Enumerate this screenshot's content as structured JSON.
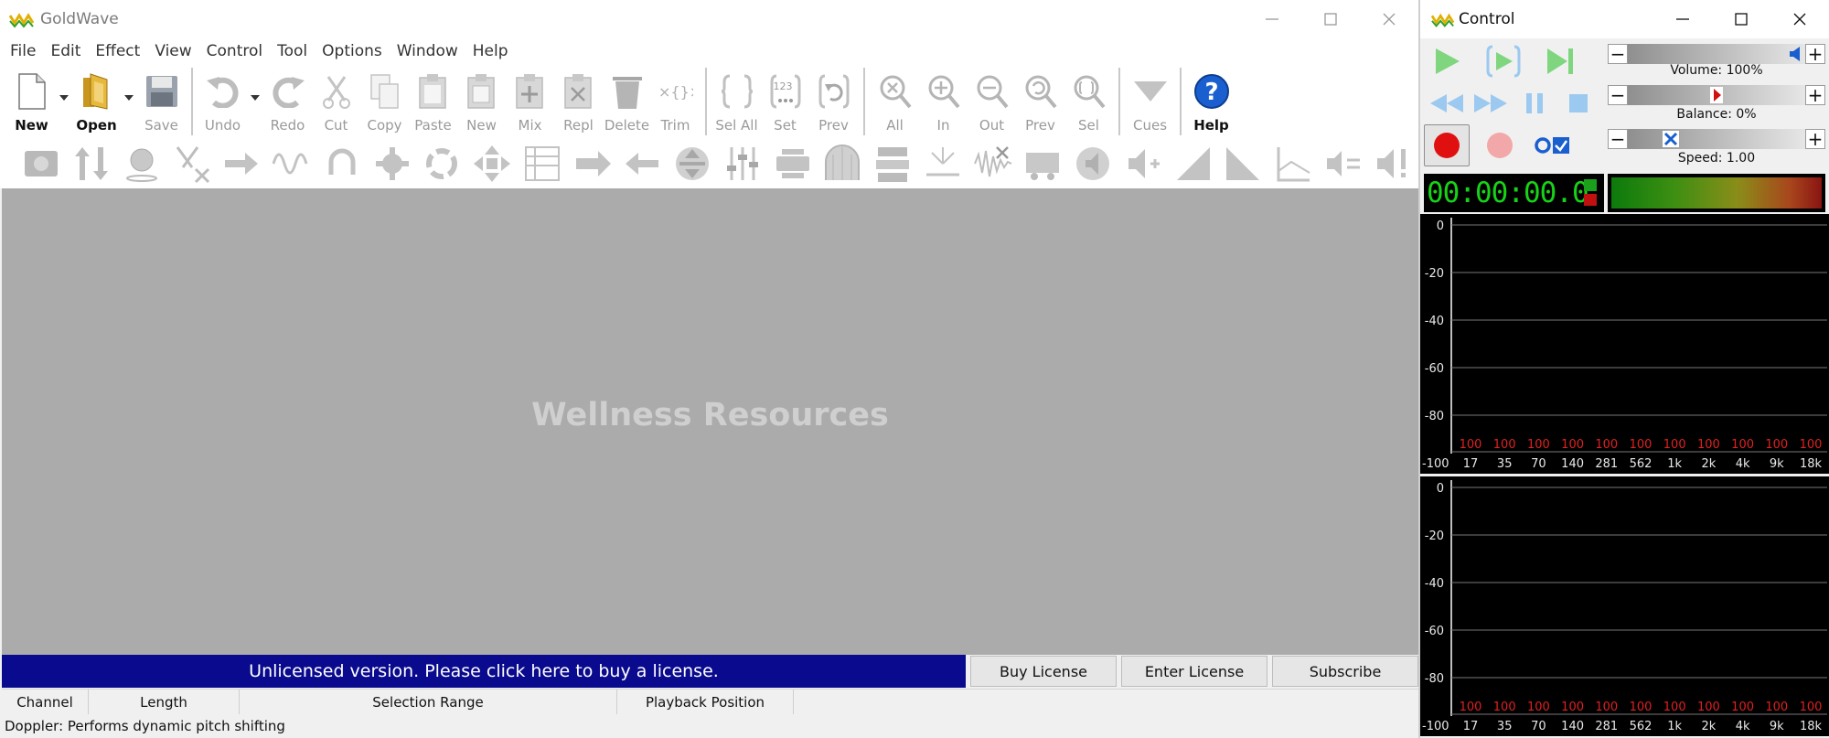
{
  "main_window": {
    "title": "GoldWave",
    "menu": [
      "File",
      "Edit",
      "Effect",
      "View",
      "Control",
      "Tool",
      "Options",
      "Window",
      "Help"
    ],
    "toolbar": {
      "new": "New",
      "open": "Open",
      "save": "Save",
      "undo": "Undo",
      "redo": "Redo",
      "cut": "Cut",
      "copy": "Copy",
      "paste": "Paste",
      "paste_new": "New",
      "mix": "Mix",
      "replace": "Repl",
      "delete": "Delete",
      "trim": "Trim",
      "select_all": "Sel All",
      "set": "Set",
      "set_icon_text": "123",
      "previous": "Prev",
      "zoom_all": "All",
      "zoom_in": "In",
      "zoom_out": "Out",
      "zoom_prev": "Prev",
      "zoom_sel": "Sel",
      "cues": "Cues",
      "help": "Help"
    },
    "workspace_text": "Wellness Resources",
    "license": {
      "message": "Unlicensed version. Please click here to buy a license.",
      "buy": "Buy License",
      "enter": "Enter License",
      "subscribe": "Subscribe"
    },
    "status_columns": [
      "Channel",
      "Length",
      "Selection Range",
      "Playback Position"
    ],
    "status_text": "Doppler: Performs dynamic pitch shifting"
  },
  "control_window": {
    "title": "Control",
    "volume_label": "Volume: 100%",
    "balance_label": "Balance: 0%",
    "speed_label": "Speed: 1.00",
    "volume_fraction": 1.0,
    "balance_percent": 0,
    "speed": 1.0,
    "time": "00:00:00.0",
    "spectrum": {
      "y_ticks": [
        "0",
        "-20",
        "-40",
        "-60",
        "-80"
      ],
      "x_first": "-100",
      "x_labels": [
        "17",
        "35",
        "70",
        "140",
        "281",
        "562",
        "1k",
        "2k",
        "4k",
        "9k",
        "18k"
      ],
      "peak_values": [
        "100",
        "100",
        "100",
        "100",
        "100",
        "100",
        "100",
        "100",
        "100",
        "100",
        "100"
      ]
    }
  },
  "colors": {
    "license_bg": "#0a0a8e",
    "workspace_bg": "#ababab",
    "timer_digits": "#17d317",
    "peak_red": "#e02020",
    "play_green": "#7fd67f",
    "record_red": "#e01010",
    "help_blue": "#1a5fcf"
  }
}
